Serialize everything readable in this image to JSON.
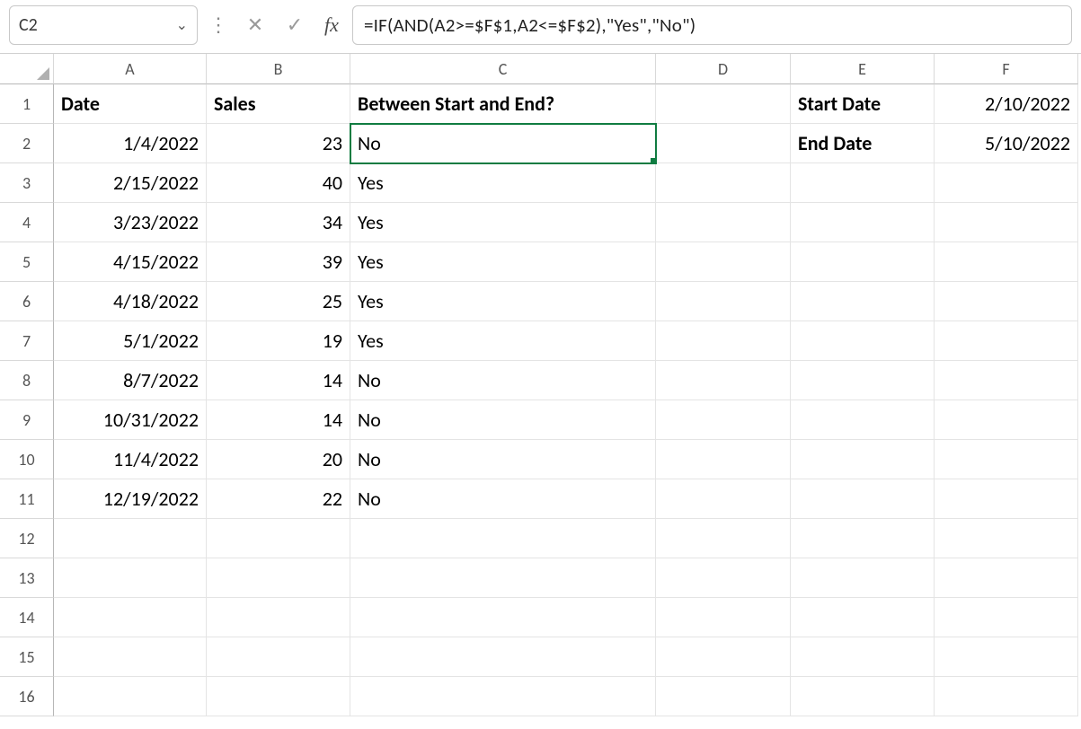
{
  "nameBox": "C2",
  "formula": "=IF(AND(A2>=$F$1,A2<=$F$2),\"Yes\",\"No\")",
  "columns": [
    "A",
    "B",
    "C",
    "D",
    "E",
    "F"
  ],
  "rowNumbers": [
    1,
    2,
    3,
    4,
    5,
    6,
    7,
    8,
    9,
    10,
    11,
    12,
    13,
    14,
    15,
    16
  ],
  "headers": {
    "A": "Date",
    "B": "Sales",
    "C": "Between Start and End?",
    "E1": "Start Date",
    "E2": "End Date",
    "F1": "2/10/2022",
    "F2": "5/10/2022"
  },
  "rows": [
    {
      "date": "1/4/2022",
      "sales": "23",
      "between": "No"
    },
    {
      "date": "2/15/2022",
      "sales": "40",
      "between": "Yes"
    },
    {
      "date": "3/23/2022",
      "sales": "34",
      "between": "Yes"
    },
    {
      "date": "4/15/2022",
      "sales": "39",
      "between": "Yes"
    },
    {
      "date": "4/18/2022",
      "sales": "25",
      "between": "Yes"
    },
    {
      "date": "5/1/2022",
      "sales": "19",
      "between": "Yes"
    },
    {
      "date": "8/7/2022",
      "sales": "14",
      "between": "No"
    },
    {
      "date": "10/31/2022",
      "sales": "14",
      "between": "No"
    },
    {
      "date": "11/4/2022",
      "sales": "20",
      "between": "No"
    },
    {
      "date": "12/19/2022",
      "sales": "22",
      "between": "No"
    }
  ],
  "selectedCell": "C2",
  "icons": {
    "cancel": "✕",
    "enter": "✓",
    "chevDown": "⌄",
    "dots": "⋮"
  }
}
